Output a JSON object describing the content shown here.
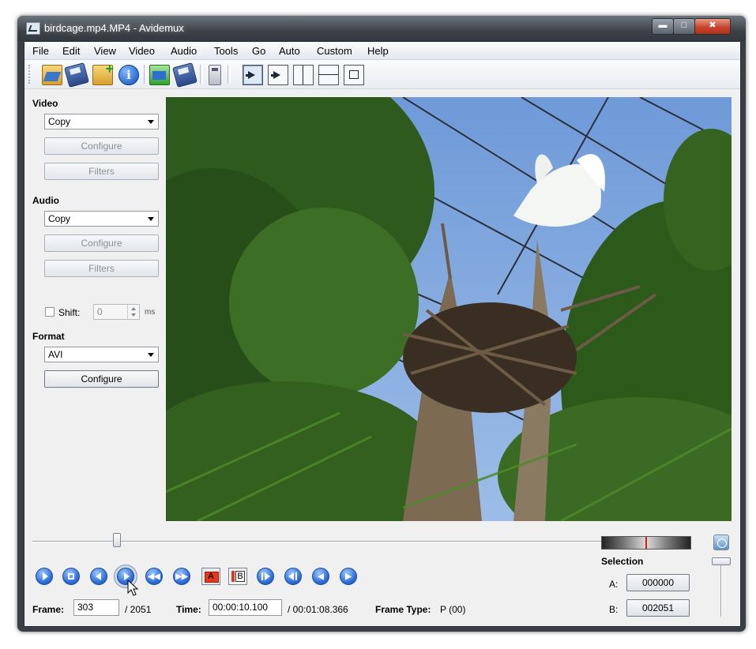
{
  "window": {
    "title": "birdcage.mp4.MP4 - Avidemux"
  },
  "menu": [
    "File",
    "Edit",
    "View",
    "Video",
    "Audio",
    "Tools",
    "Go",
    "Auto",
    "Custom",
    "Help"
  ],
  "toolbar_icons": [
    "open-icon",
    "save-icon",
    "append-icon",
    "info-icon",
    "open-folder-icon",
    "save-project-icon",
    "calculator-icon",
    "view-output-icon",
    "view-preview-icon",
    "view-side-icon",
    "view-top-icon",
    "view-separate-icon"
  ],
  "video": {
    "title": "Video",
    "codec": "Copy",
    "configure": "Configure",
    "filters": "Filters"
  },
  "audio": {
    "title": "Audio",
    "codec": "Copy",
    "configure": "Configure",
    "filters": "Filters",
    "shift_label": "Shift:",
    "shift_value": "0",
    "ms": "ms"
  },
  "format": {
    "title": "Format",
    "value": "AVI",
    "configure": "Configure"
  },
  "status": {
    "frame_label": "Frame:",
    "frame_value": "303",
    "frame_total": "/ 2051",
    "time_label": "Time:",
    "time_value": "00:00:10.100",
    "time_total": "/ 00:01:08.366",
    "frame_type_label": "Frame Type:",
    "frame_type_value": "P (00)"
  },
  "position_fraction": 0.148,
  "selection": {
    "title": "Selection",
    "a_label": "A:",
    "a_value": "000000",
    "b_label": "B:",
    "b_value": "002051"
  },
  "markers": {
    "a": "A",
    "b": "B"
  },
  "colors": {
    "accent": "#2a6bd6",
    "marker_red": "#e8361e"
  }
}
